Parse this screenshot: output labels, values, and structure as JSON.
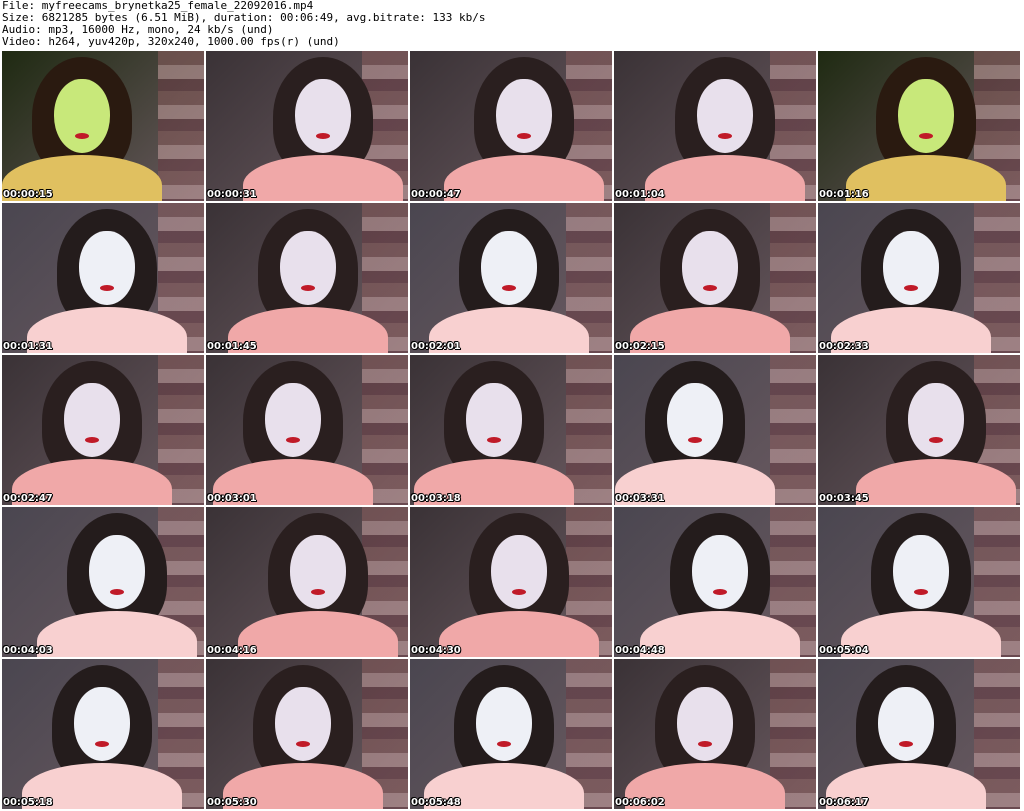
{
  "header": {
    "lines": [
      "File: myfreecams_brynetka25_female_22092016.mp4",
      "Size: 6821285 bytes (6.51 MiB), duration: 00:06:49, avg.bitrate: 133 kb/s",
      "Audio: mp3, 16000 Hz, mono, 24 kb/s (und)",
      "Video: h264, yuv420p, 320x240, 1000.00 fps(r) (und)"
    ]
  },
  "thumbnails": [
    {
      "timestamp": "00:00:15",
      "palette": "green"
    },
    {
      "timestamp": "00:00:31",
      "palette": "pink"
    },
    {
      "timestamp": "00:00:47",
      "palette": "pink"
    },
    {
      "timestamp": "00:01:04",
      "palette": "pink"
    },
    {
      "timestamp": "00:01:16",
      "palette": "green"
    },
    {
      "timestamp": "00:01:31",
      "palette": "pale"
    },
    {
      "timestamp": "00:01:45",
      "palette": "pink"
    },
    {
      "timestamp": "00:02:01",
      "palette": "pale"
    },
    {
      "timestamp": "00:02:15",
      "palette": "pink"
    },
    {
      "timestamp": "00:02:33",
      "palette": "pale"
    },
    {
      "timestamp": "00:02:47",
      "palette": "pink"
    },
    {
      "timestamp": "00:03:01",
      "palette": "pink"
    },
    {
      "timestamp": "00:03:18",
      "palette": "pink"
    },
    {
      "timestamp": "00:03:31",
      "palette": "pale"
    },
    {
      "timestamp": "00:03:45",
      "palette": "pink"
    },
    {
      "timestamp": "00:04:03",
      "palette": "pale"
    },
    {
      "timestamp": "00:04:16",
      "palette": "pink"
    },
    {
      "timestamp": "00:04:30",
      "palette": "pink"
    },
    {
      "timestamp": "00:04:48",
      "palette": "pale"
    },
    {
      "timestamp": "00:05:04",
      "palette": "pale"
    },
    {
      "timestamp": "00:05:18",
      "palette": "pale"
    },
    {
      "timestamp": "00:05:30",
      "palette": "pink"
    },
    {
      "timestamp": "00:05:48",
      "palette": "pale"
    },
    {
      "timestamp": "00:06:02",
      "palette": "pink"
    },
    {
      "timestamp": "00:06:17",
      "palette": "pale"
    }
  ],
  "colors": {
    "green": {
      "bg": "#1f2a12",
      "face": "#c8e87a",
      "hair": "#2a1a10",
      "body": "#e0c060"
    },
    "pink": {
      "bg": "#3a3236",
      "face": "#e8e0ec",
      "hair": "#2a1f1f",
      "body": "#f0a8a8"
    },
    "pale": {
      "bg": "#4a4650",
      "face": "#eef0f6",
      "hair": "#241c1c",
      "body": "#f8d0d0"
    }
  }
}
